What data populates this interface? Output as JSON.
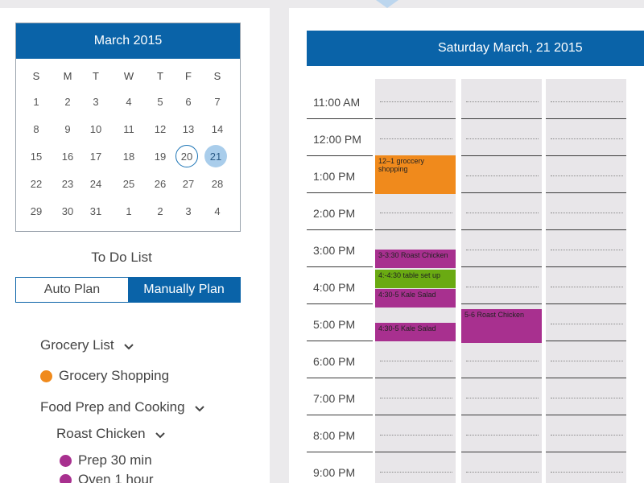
{
  "mini_calendar": {
    "title": "March 2015",
    "weekdays": [
      "S",
      "M",
      "T",
      "W",
      "T",
      "F",
      "S"
    ],
    "weeks": [
      [
        "1",
        "2",
        "3",
        "4",
        "5",
        "6",
        "7"
      ],
      [
        "8",
        "9",
        "10",
        "11",
        "12",
        "13",
        "14"
      ],
      [
        "15",
        "16",
        "17",
        "18",
        "19",
        "20",
        "21"
      ],
      [
        "22",
        "23",
        "24",
        "25",
        "26",
        "27",
        "28"
      ],
      [
        "29",
        "30",
        "31",
        "1",
        "2",
        "3",
        "4"
      ]
    ],
    "today": "20",
    "selected": "21"
  },
  "todo": {
    "title": "To Do List",
    "auto_label": "Auto Plan",
    "manual_label": "Manually Plan",
    "items": [
      {
        "label": "Grocery List",
        "chevron": true
      },
      {
        "label": "Grocery Shopping",
        "dot": "#f08a1c"
      },
      {
        "label": "Food Prep and Cooking",
        "chevron": true
      },
      {
        "label": "Roast Chicken",
        "chevron": true
      },
      {
        "label": "Prep 30 min",
        "dot": "#a8308f"
      },
      {
        "label": "Oven 1 hour",
        "dot": "#a8308f"
      }
    ]
  },
  "day_view": {
    "title": "Saturday March, 21 2015",
    "hours": [
      "11:00 AM",
      "12:00 PM",
      "1:00 PM",
      "2:00 PM",
      "3:00 PM",
      "4:00 PM",
      "5:00 PM",
      "6:00 PM",
      "7:00 PM",
      "8:00 PM",
      "9:00 PM"
    ],
    "events": [
      {
        "label": "12–1 groccery shopping",
        "color": "#f08a1c"
      },
      {
        "label": "3-3:30 Roast Chicken",
        "color": "#a8308f"
      },
      {
        "label": "4:-4:30 table set up",
        "color": "#6aaa12"
      },
      {
        "label": "4:30-5 Kale Salad",
        "color": "#a8308f"
      },
      {
        "label": "4:30-5 Kale Salad",
        "color": "#a8308f"
      },
      {
        "label": "5-6 Roast Chicken",
        "color": "#a8308f"
      }
    ]
  }
}
